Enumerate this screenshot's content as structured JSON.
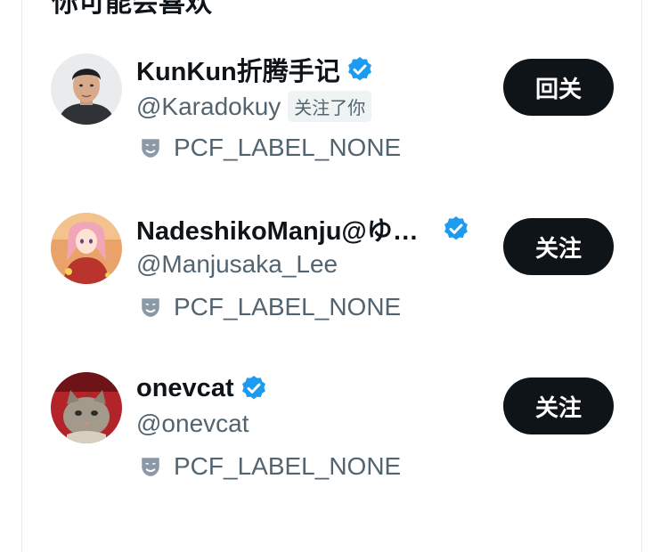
{
  "section": {
    "title": "你可能会喜欢"
  },
  "colors": {
    "verified_blue": "#1d9bf0",
    "button_bg": "#0f1419",
    "secondary_text": "#536471",
    "badge_bg": "#eff3f4"
  },
  "users": [
    {
      "display_name": "KunKun折腾手记",
      "handle": "@Karadokuy",
      "follows_you": "关注了你",
      "label_icon": "mask-icon",
      "label": "PCF_LABEL_NONE",
      "button": "回关",
      "verified_icon": "verified-badge-icon"
    },
    {
      "display_name": "NadeshikoManju@ゆ…",
      "handle": "@Manjusaka_Lee",
      "label_icon": "mask-icon",
      "label": "PCF_LABEL_NONE",
      "button": "关注",
      "verified_icon": "verified-badge-icon"
    },
    {
      "display_name": "onevcat",
      "handle": "@onevcat",
      "label_icon": "mask-icon",
      "label": "PCF_LABEL_NONE",
      "button": "关注",
      "verified_icon": "verified-badge-icon"
    }
  ]
}
